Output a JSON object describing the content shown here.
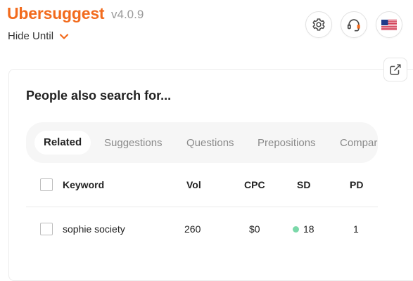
{
  "header": {
    "app_name": "Ubersuggest",
    "version": "v4.0.9",
    "hide_until_label": "Hide Until"
  },
  "icons": {
    "settings": "gear-icon",
    "support": "headset-icon",
    "language": "us-flag-icon",
    "open_external": "external-link-icon"
  },
  "colors": {
    "brand": "#f26b1d",
    "sd_easy": "#7bd8a9"
  },
  "panel": {
    "title": "People also search for...",
    "tabs": [
      "Related",
      "Suggestions",
      "Questions",
      "Prepositions",
      "Compar"
    ],
    "active_tab": "Related",
    "table": {
      "headers": [
        "Keyword",
        "Vol",
        "CPC",
        "SD",
        "PD"
      ],
      "rows": [
        {
          "keyword": "sophie society",
          "vol": "260",
          "cpc": "$0",
          "sd": "18",
          "pd": "1"
        }
      ]
    }
  }
}
